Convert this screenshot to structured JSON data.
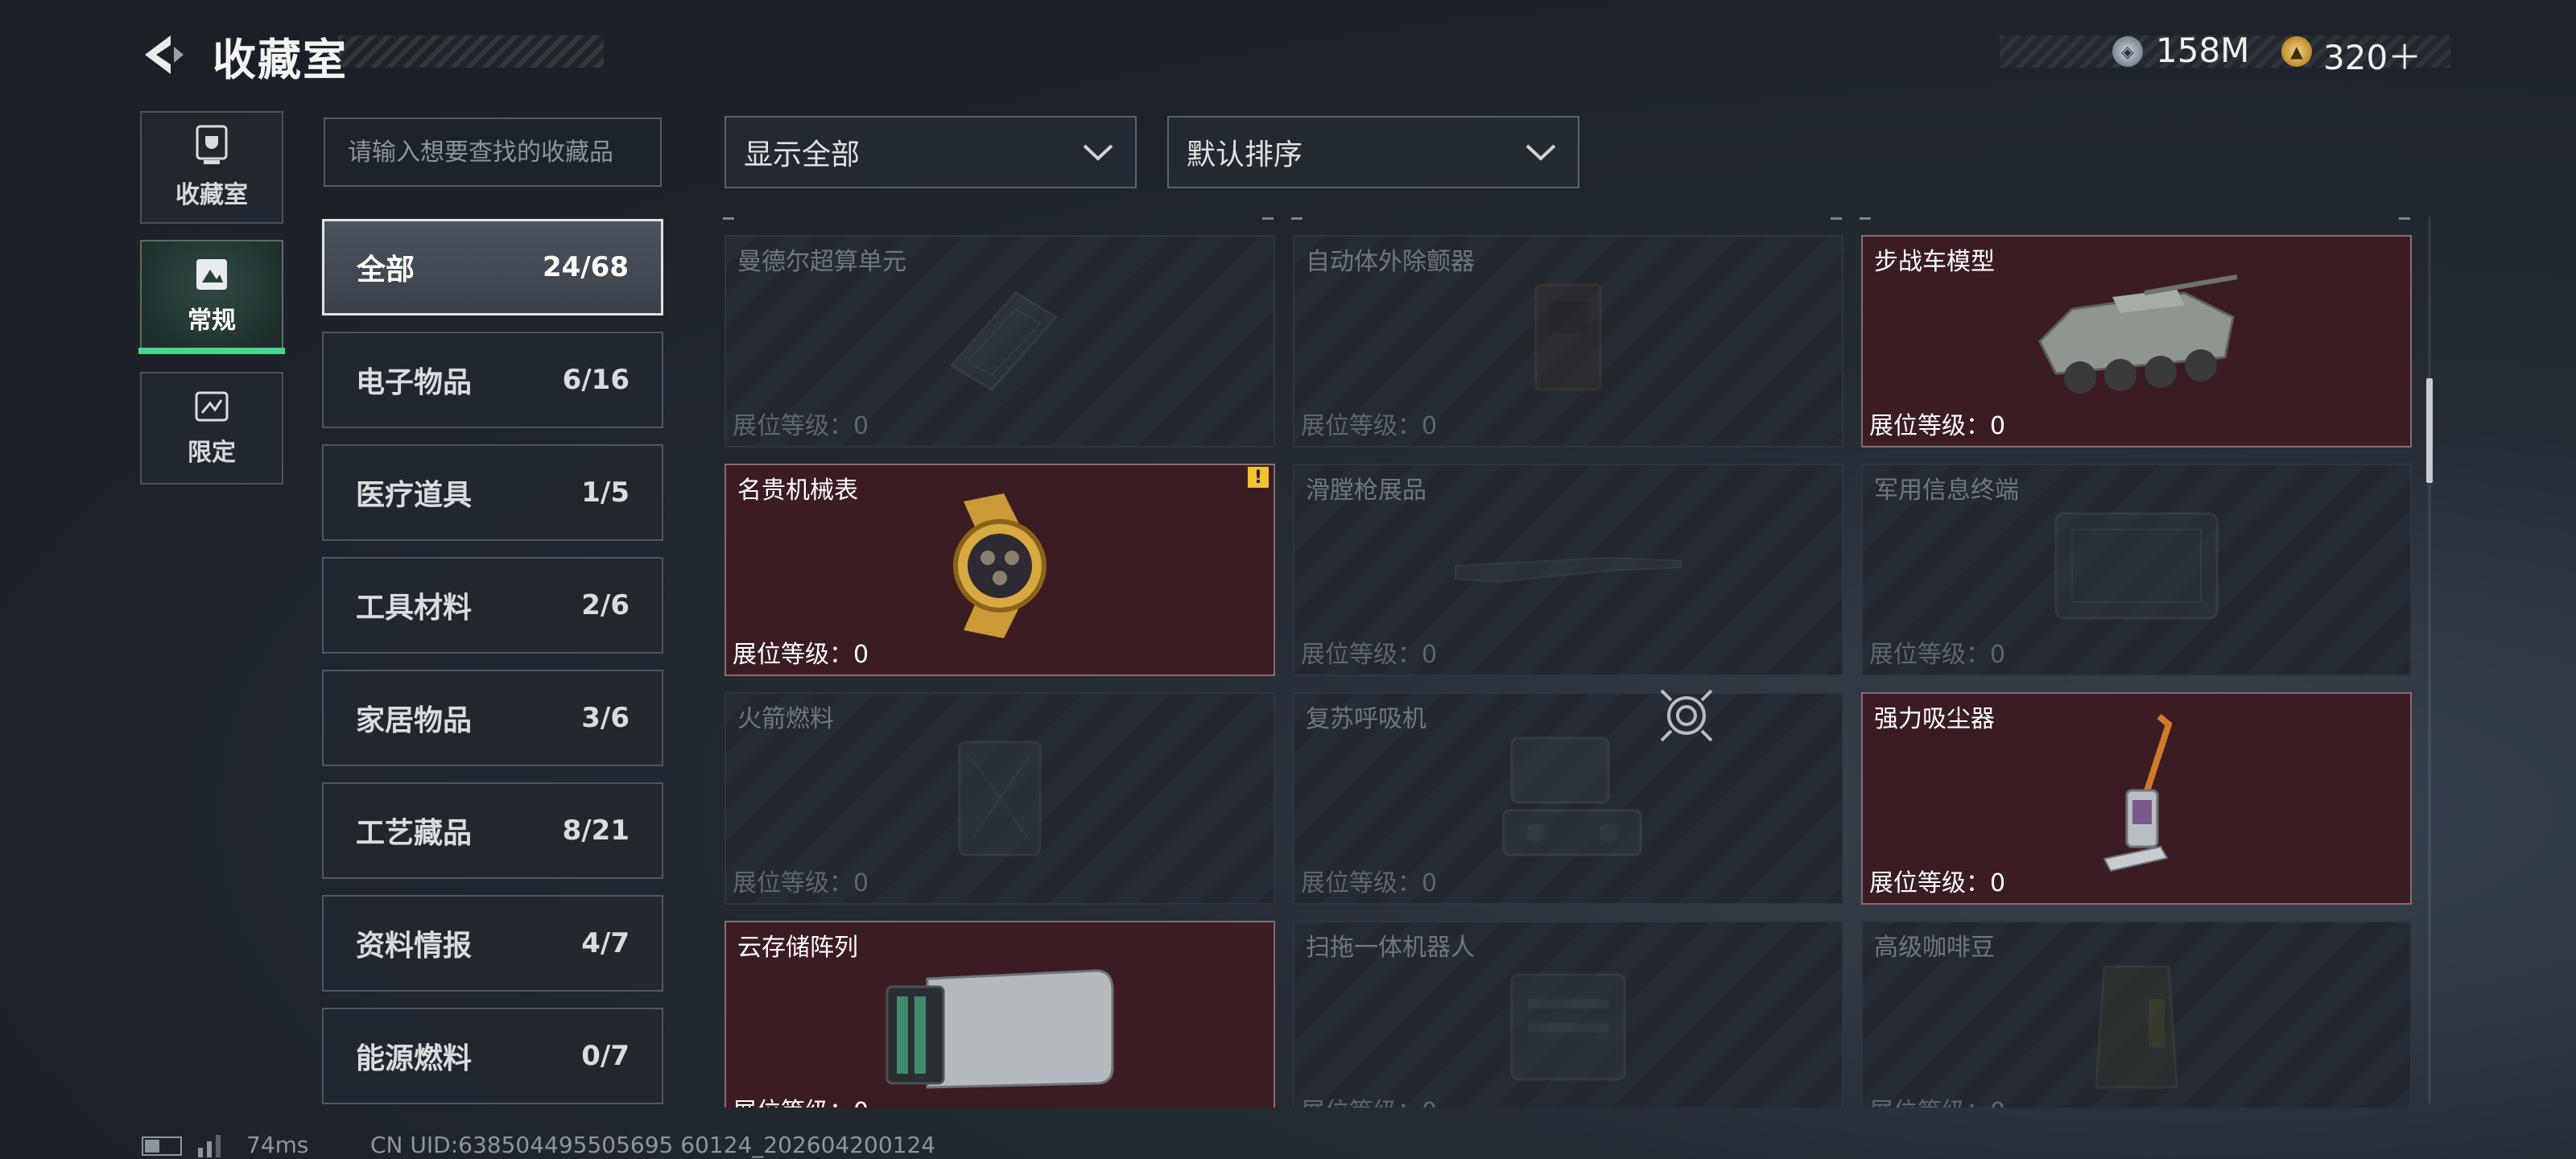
{
  "header": {
    "title": "收藏室"
  },
  "currency": [
    {
      "icon": "silver-coin-icon",
      "value": "158M"
    },
    {
      "icon": "gold-coin-icon",
      "value": "320＋"
    }
  ],
  "nav": [
    {
      "label": "收藏室",
      "icon": "trophy-icon",
      "active": false
    },
    {
      "label": "常规",
      "icon": "image-frame-icon",
      "active": true
    },
    {
      "label": "限定",
      "icon": "ticket-icon",
      "active": false
    }
  ],
  "search": {
    "placeholder": "请输入想要查找的收藏品"
  },
  "categories": [
    {
      "name": "全部",
      "count": "24/68",
      "active": true
    },
    {
      "name": "电子物品",
      "count": "6/16"
    },
    {
      "name": "医疗道具",
      "count": "1/5"
    },
    {
      "name": "工具材料",
      "count": "2/6"
    },
    {
      "name": "家居物品",
      "count": "3/6"
    },
    {
      "name": "工艺藏品",
      "count": "8/21"
    },
    {
      "name": "资料情报",
      "count": "4/7"
    },
    {
      "name": "能源燃料",
      "count": "0/7"
    }
  ],
  "filters": {
    "show": "显示全部",
    "sort": "默认排序"
  },
  "level_label": "展位等级：0",
  "items": [
    {
      "name": "曼德尔超算单元",
      "owned": false,
      "icon": "server-box-icon"
    },
    {
      "name": "自动体外除颤器",
      "owned": false,
      "icon": "defibrillator-icon"
    },
    {
      "name": "步战车模型",
      "owned": true,
      "icon": "armored-vehicle-icon"
    },
    {
      "name": "名贵机械表",
      "owned": true,
      "icon": "gold-watch-icon",
      "alert": "!"
    },
    {
      "name": "滑膛枪展品",
      "owned": false,
      "icon": "musket-icon"
    },
    {
      "name": "军用信息终端",
      "owned": false,
      "icon": "rugged-case-icon"
    },
    {
      "name": "火箭燃料",
      "owned": false,
      "icon": "fuel-canister-icon"
    },
    {
      "name": "复苏呼吸机",
      "owned": false,
      "icon": "ventilator-icon"
    },
    {
      "name": "强力吸尘器",
      "owned": true,
      "icon": "vacuum-cleaner-icon"
    },
    {
      "name": "云存储阵列",
      "owned": true,
      "icon": "storage-array-icon"
    },
    {
      "name": "扫拖一体机器人",
      "owned": false,
      "icon": "mop-robot-icon"
    },
    {
      "name": "高级咖啡豆",
      "owned": false,
      "icon": "coffee-bag-icon"
    }
  ],
  "status": {
    "ping": "74ms",
    "uid": "CN UID:638504495505695 60124_202604200124"
  }
}
